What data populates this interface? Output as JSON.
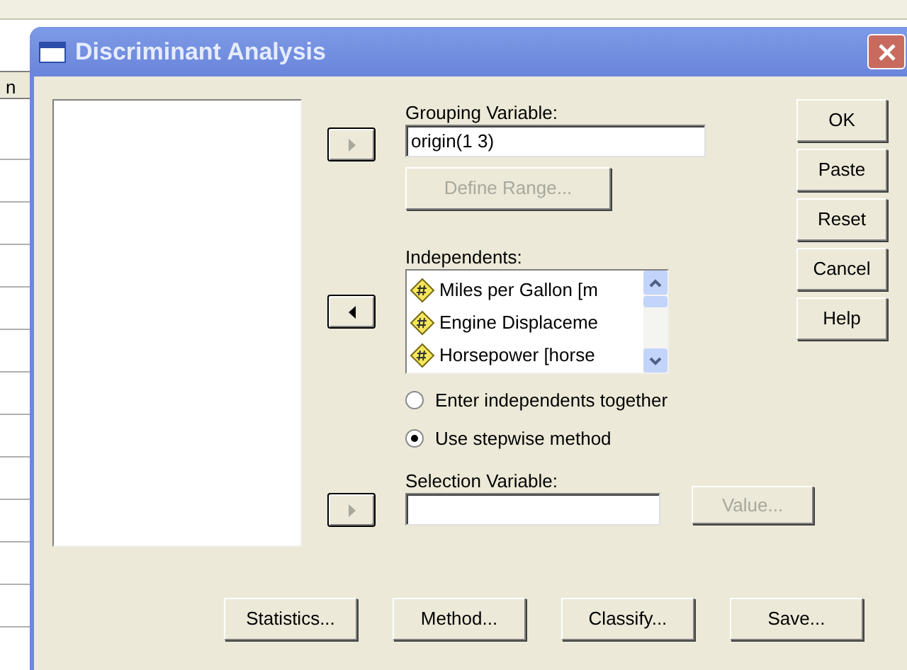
{
  "background": {
    "cell_text": "n"
  },
  "window": {
    "title": "Discriminant Analysis"
  },
  "grouping": {
    "label": "Grouping Variable:",
    "value": "origin(1 3)",
    "move_disabled": true,
    "define_range": {
      "label": "Define Range...",
      "disabled": true
    }
  },
  "independents": {
    "label": "Independents:",
    "move_disabled": false,
    "items": [
      {
        "label": "Miles per Gallon [m"
      },
      {
        "label": "Engine Displaceme"
      },
      {
        "label": "Horsepower [horse"
      }
    ]
  },
  "method_options": [
    {
      "label": "Enter independents together",
      "selected": false
    },
    {
      "label": "Use stepwise method",
      "selected": true
    }
  ],
  "selection": {
    "label": "Selection Variable:",
    "move_disabled": true,
    "value_button": {
      "label": "Value...",
      "disabled": true
    }
  },
  "side_buttons": [
    {
      "label": "OK"
    },
    {
      "label": "Paste"
    },
    {
      "label": "Reset"
    },
    {
      "label": "Cancel"
    },
    {
      "label": "Help"
    }
  ],
  "bottom_buttons": [
    {
      "label": "Statistics..."
    },
    {
      "label": "Method..."
    },
    {
      "label": "Classify..."
    },
    {
      "label": "Save..."
    }
  ]
}
